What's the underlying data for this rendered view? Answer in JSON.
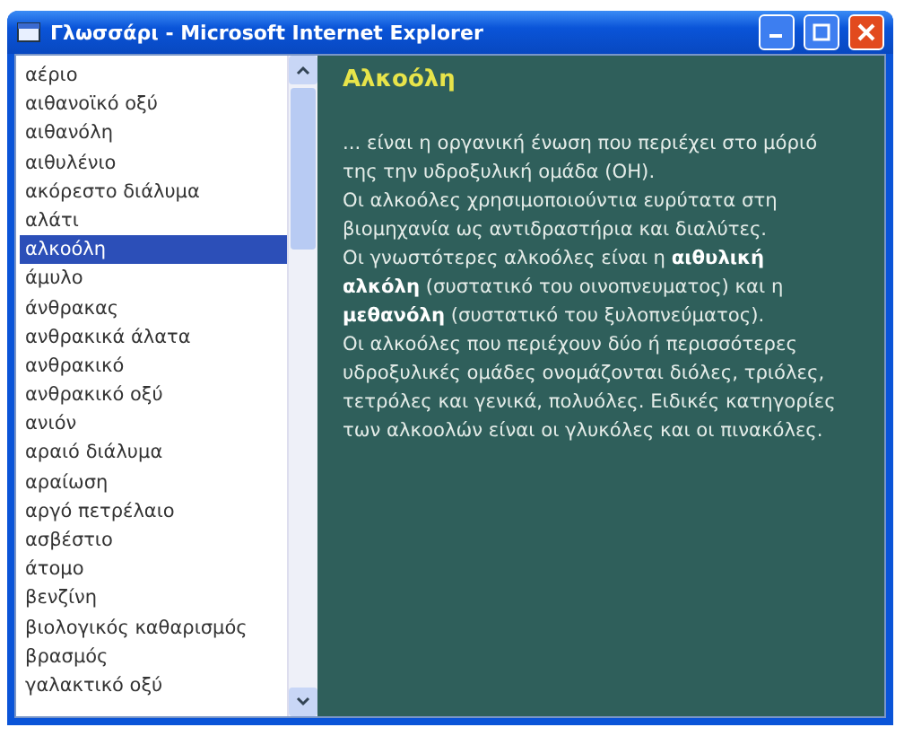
{
  "window": {
    "title": "Γλωσσάρι - Microsoft Internet Explorer"
  },
  "glossary": {
    "items": [
      {
        "label": "αέριο",
        "selected": false
      },
      {
        "label": "αιθανοϊκό οξύ",
        "selected": false
      },
      {
        "label": "αιθανόλη",
        "selected": false
      },
      {
        "label": "αιθυλένιο",
        "selected": false
      },
      {
        "label": "ακόρεστο διάλυμα",
        "selected": false
      },
      {
        "label": "αλάτι",
        "selected": false
      },
      {
        "label": "αλκοόλη",
        "selected": true
      },
      {
        "label": "άμυλο",
        "selected": false
      },
      {
        "label": "άνθρακας",
        "selected": false
      },
      {
        "label": "ανθρακικά άλατα",
        "selected": false
      },
      {
        "label": "ανθρακικό",
        "selected": false
      },
      {
        "label": "ανθρακικό οξύ",
        "selected": false
      },
      {
        "label": "ανιόν",
        "selected": false
      },
      {
        "label": "αραιό διάλυμα",
        "selected": false
      },
      {
        "label": "αραίωση",
        "selected": false
      },
      {
        "label": "αργό πετρέλαιο",
        "selected": false
      },
      {
        "label": "ασβέστιο",
        "selected": false
      },
      {
        "label": "άτομο",
        "selected": false
      },
      {
        "label": "βενζίνη",
        "selected": false
      },
      {
        "label": "βιολογικός καθαρισμός",
        "selected": false
      },
      {
        "label": "βρασμός",
        "selected": false
      },
      {
        "label": "γαλακτικό οξύ",
        "selected": false
      }
    ]
  },
  "entry": {
    "title": "Αλκοόλη",
    "paragraphs": [
      "... είναι η οργανική ένωση που περιέχει στο μόριό της την υδροξυλική ομάδα (ΟΗ).",
      "Οι αλκοόλες χρησιμοποιούντια ευρύτατα στη βιομηχανία ως αντιδραστήρια και διαλύτες.",
      "Οι γνωστότερες αλκοόλες είναι η **αιθυλική αλκόλη** (συστατικό του οινοπνευματος) και η **μεθανόλη** (συστατικό του ξυλοπνεύματος).",
      "Οι αλκοόλες που περιέχουν δύο ή περισσότερες υδροξυλικές ομάδες ονομάζονται διόλες, τριόλες, τετρόλες και γενικά, πολυόλες. Ειδικές κατηγορίες των αλκοολών είναι οι γλυκόλες και οι πινακόλες."
    ]
  }
}
